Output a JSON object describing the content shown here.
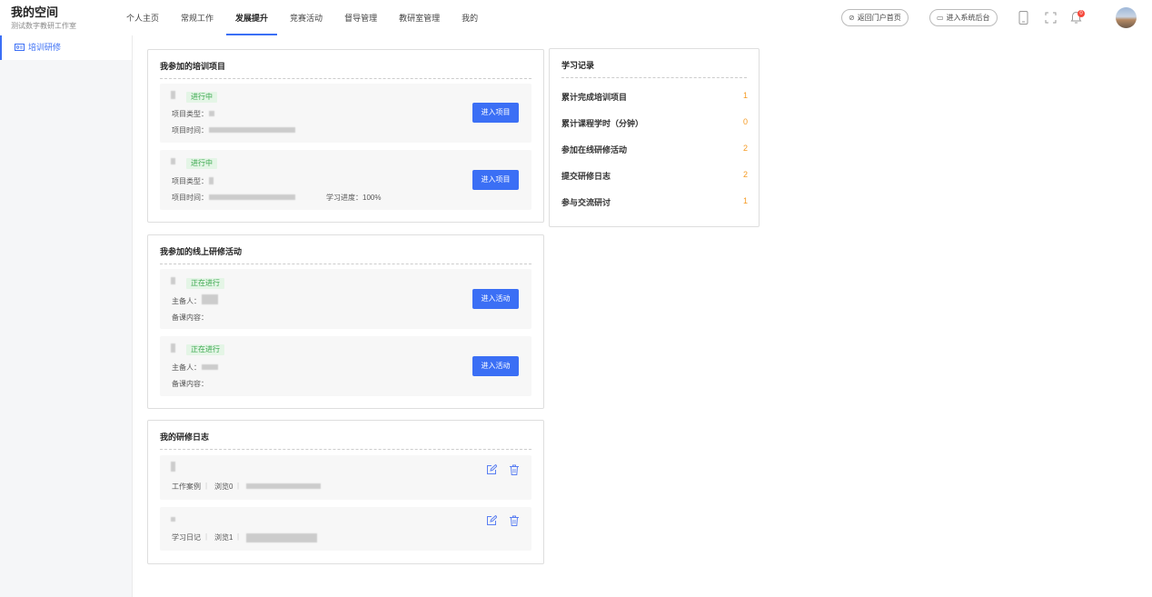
{
  "brand": {
    "title": "我的空间",
    "subtitle": "测试数字教研工作室"
  },
  "nav": [
    "个人主页",
    "常规工作",
    "发展提升",
    "竞赛活动",
    "督导管理",
    "教研室管理",
    "我的"
  ],
  "header": {
    "portal_label": "返回门户首页",
    "backend_label": "进入系统后台",
    "bell_count": "0"
  },
  "sidebar": {
    "item_label": "培训研修"
  },
  "projects": {
    "title": "我参加的培训项目",
    "items": [
      {
        "status": "进行中",
        "type_label": "项目类型：",
        "time_label": "项目时间：",
        "button": "进入项目",
        "progress": ""
      },
      {
        "status": "进行中",
        "type_label": "项目类型：",
        "time_label": "项目时间：",
        "button": "进入项目",
        "progress": "学习进度：100%"
      }
    ]
  },
  "activities": {
    "title": "我参加的线上研修活动",
    "items": [
      {
        "status": "正在进行",
        "host_label": "主备人：",
        "content_label": "备课内容：",
        "button": "进入活动"
      },
      {
        "status": "正在进行",
        "host_label": "主备人：",
        "content_label": "备课内容：",
        "button": "进入活动"
      }
    ]
  },
  "logs": {
    "title": "我的研修日志",
    "items": [
      {
        "category": "工作案例",
        "views": "浏览0"
      },
      {
        "category": "学习日记",
        "views": "浏览1"
      }
    ]
  },
  "record": {
    "title": "学习记录",
    "rows": [
      {
        "label": "累计完成培训项目",
        "value": "1"
      },
      {
        "label": "累计课程学时（分钟）",
        "value": "0"
      },
      {
        "label": "参加在线研修活动",
        "value": "2"
      },
      {
        "label": "提交研修日志",
        "value": "2"
      },
      {
        "label": "参与交流研讨",
        "value": "1"
      }
    ]
  },
  "colors": {
    "accent": "#3b6ff5",
    "status_green": "#3aa84d",
    "value_orange": "#f59a23",
    "badge_red": "#f5483b"
  }
}
